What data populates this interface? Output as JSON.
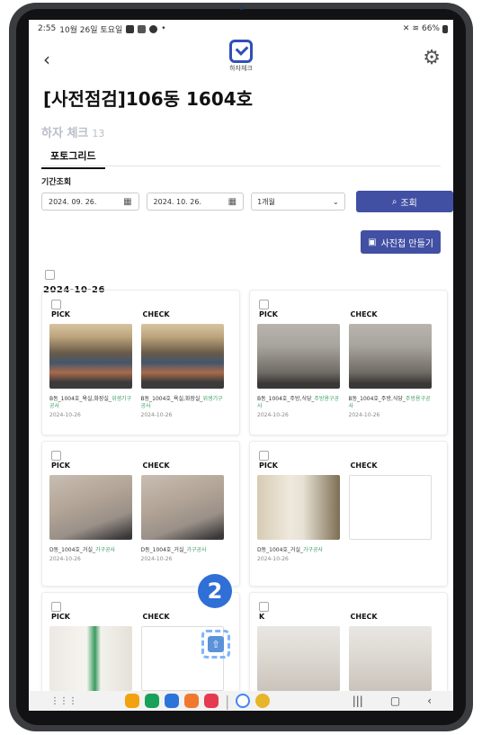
{
  "status": {
    "time": "2:55",
    "date": "10월 26일 토요일",
    "battery": "66%"
  },
  "header": {
    "app_name": "하자체크",
    "title": "[사전점검]106동 1604호"
  },
  "section": {
    "title": "하자 체크",
    "count": "13"
  },
  "tabs": [
    {
      "label": "포토그리드"
    }
  ],
  "filter": {
    "period_label": "기간조회",
    "start_date": "2024. 09. 26.",
    "end_date": "2024. 10. 26.",
    "range_select": "1개월",
    "search_label": "조회"
  },
  "album_button": "사진첩 만들기",
  "group_date": "2024-10-26",
  "cards": [
    {
      "pick_label": "PICK",
      "check_label": "CHECK",
      "pick_caption_prefix": "B동_1004호_욕실,화장실_",
      "pick_caption_hl": "위생기구공사",
      "pick_date": "2024-10-26",
      "check_caption_prefix": "B동_1004호_욕실,화장실_",
      "check_caption_hl": "위생기구공사",
      "check_date": "2024-10-26"
    },
    {
      "pick_label": "PICK",
      "check_label": "CHECK",
      "pick_caption_prefix": "B동_1004호_주방,식당_",
      "pick_caption_hl": "주방용구공사",
      "pick_date": "2024-10-26",
      "check_caption_prefix": "B동_1004호_주방,식당_",
      "check_caption_hl": "주방용구공사",
      "check_date": "2024-10-26"
    },
    {
      "pick_label": "PICK",
      "check_label": "CHECK",
      "pick_caption_prefix": "D동_1004호_거실_",
      "pick_caption_hl": "가구공사",
      "pick_date": "2024-10-26",
      "check_caption_prefix": "D동_1004호_거실_",
      "check_caption_hl": "가구공사",
      "check_date": "2024-10-26"
    },
    {
      "pick_label": "PICK",
      "check_label": "CHECK",
      "pick_caption_prefix": "D동_1004호_거실_",
      "pick_caption_hl": "가구공사",
      "pick_date": "2024-10-26",
      "check_caption_prefix": "",
      "check_caption_hl": "",
      "check_date": ""
    },
    {
      "pick_label": "PICK",
      "check_label": "CHECK"
    },
    {
      "pick_label": "K",
      "check_label": "CHECK"
    }
  ],
  "overlay": {
    "step_number": "2"
  },
  "colors": {
    "primary": "#4250a4",
    "highlight": "#3a9c5d",
    "step_badge": "#2f6fd6"
  }
}
